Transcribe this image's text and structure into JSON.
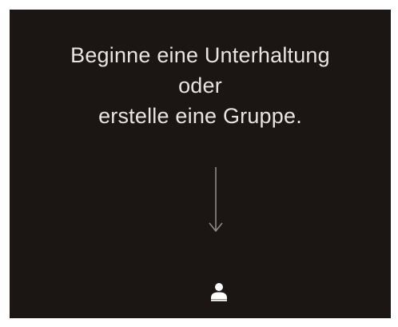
{
  "empty_state": {
    "line1": "Beginne eine Unterhaltung",
    "line2": "oder",
    "line3": "erstelle eine Gruppe."
  },
  "icons": {
    "arrow": "arrow-down-icon",
    "contacts": "person-icon"
  },
  "colors": {
    "background": "#1b1614",
    "text": "#e7e4e1",
    "icon": "#ffffff"
  }
}
